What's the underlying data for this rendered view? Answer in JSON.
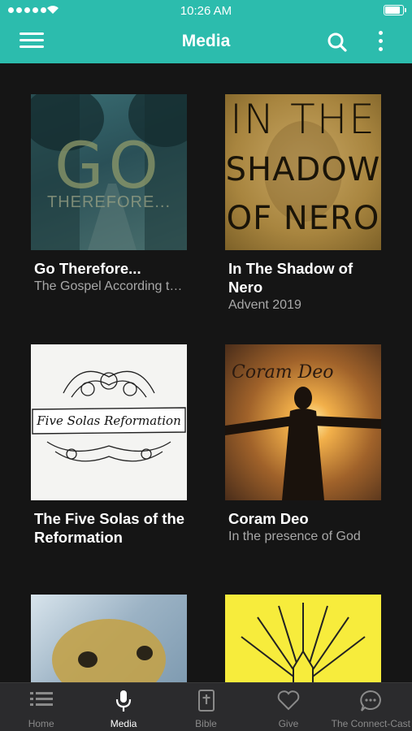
{
  "status_bar": {
    "time": "10:26 AM",
    "battery_level": 0.9
  },
  "header": {
    "title": "Media",
    "icons": [
      "menu-icon",
      "search-icon",
      "more-vertical-icon"
    ]
  },
  "media_items": [
    {
      "title": "Go Therefore...",
      "subtitle": "The Gospel According to...",
      "art_text": [
        "GO",
        "THEREFORE..."
      ]
    },
    {
      "title": "In The Shadow of Nero",
      "subtitle": "Advent 2019",
      "art_text": [
        "IN THE",
        "SHADOW",
        "OF NERO"
      ]
    },
    {
      "title": "The Five Solas of the Reformation",
      "subtitle": "",
      "art_text": [
        "Five Solas",
        "Reformation"
      ]
    },
    {
      "title": "Coram Deo",
      "subtitle": "In the presence of God",
      "art_text": [
        "Coram Deo"
      ]
    },
    {
      "title": "",
      "subtitle": "",
      "art_text": []
    },
    {
      "title": "",
      "subtitle": "",
      "art_text": []
    }
  ],
  "tabbar": {
    "active": "Media",
    "tabs": [
      {
        "label": "Home",
        "icon": "list-icon"
      },
      {
        "label": "Media",
        "icon": "microphone-icon"
      },
      {
        "label": "Bible",
        "icon": "bible-icon"
      },
      {
        "label": "Give",
        "icon": "heart-icon"
      },
      {
        "label": "The Connect-Cast",
        "icon": "chat-bubble-icon"
      }
    ]
  },
  "colors": {
    "accent": "#2cbcad",
    "background": "#151515",
    "tabbar": "#2b2b2d"
  }
}
